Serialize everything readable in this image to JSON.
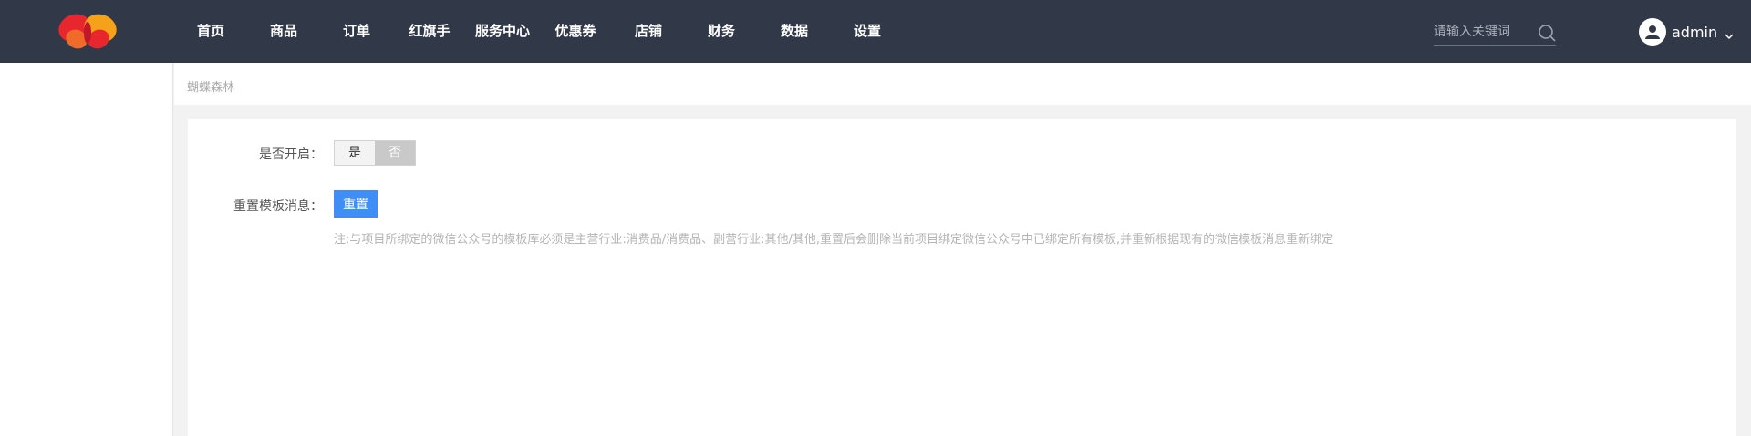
{
  "header": {
    "nav": [
      "首页",
      "商品",
      "订单",
      "红旗手",
      "服务中心",
      "优惠券",
      "店铺",
      "财务",
      "数据",
      "设置"
    ],
    "search": {
      "placeholder": "请输入关键词"
    },
    "user": {
      "name": "admin"
    }
  },
  "breadcrumb": {
    "current": "蝴蝶森林"
  },
  "form": {
    "enable": {
      "label": "是否开启：",
      "yes": "是",
      "no": "否",
      "selected": "否"
    },
    "reset": {
      "label": "重置模板消息：",
      "button": "重置",
      "note": "注:与项目所绑定的微信公众号的模板库必须是主营行业:消费品/消费品、副营行业:其他/其他,重置后会删除当前项目绑定微信公众号中已绑定所有模板,并重新根据现有的微信模板消息重新绑定"
    }
  },
  "colors": {
    "topbar": "#313848",
    "primary_button": "#3f8ef5",
    "switch_selected": "#c9c9c9"
  },
  "icons": {
    "logo": "butterfly-logo",
    "search": "search-icon",
    "avatar": "user-icon",
    "dropdown": "chevron-down-icon"
  }
}
